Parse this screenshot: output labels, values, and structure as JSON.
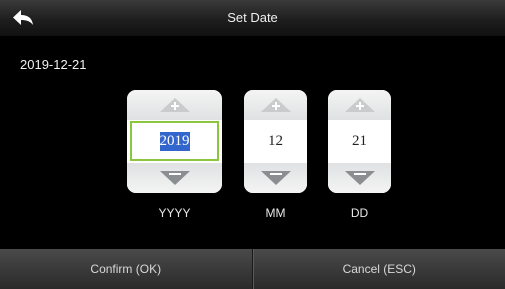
{
  "header": {
    "title": "Set Date",
    "back_icon": "back-arrow-icon"
  },
  "current_date": "2019-12-21",
  "fields": [
    {
      "value": "2019",
      "label": "YYYY",
      "selected": true
    },
    {
      "value": "12",
      "label": "MM",
      "selected": false
    },
    {
      "value": "21",
      "label": "DD",
      "selected": false
    }
  ],
  "icons": {
    "increment": "plus-icon",
    "decrement": "minus-icon"
  },
  "footer": {
    "confirm_label": "Confirm (OK)",
    "cancel_label": "Cancel (ESC)"
  },
  "colors": {
    "selection_border": "#8cc63f",
    "selection_highlight": "#3366cc"
  }
}
